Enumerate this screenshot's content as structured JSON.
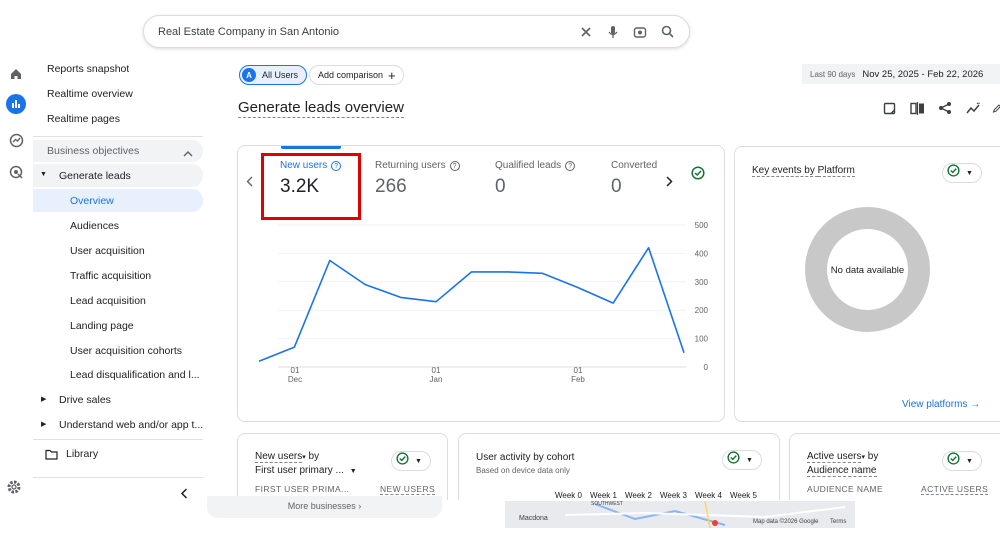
{
  "search": {
    "query": "Real Estate Company in San Antonio"
  },
  "nav": {
    "items": [
      "Reports snapshot",
      "Realtime overview",
      "Realtime pages"
    ],
    "section": "Business objectives",
    "group": "Generate leads",
    "group_items": [
      "Overview",
      "Audiences",
      "User acquisition",
      "Traffic acquisition",
      "Lead acquisition",
      "Landing page",
      "User acquisition cohorts",
      "Lead disqualification and l..."
    ],
    "collapsed": [
      "Drive sales",
      "Understand web and/or app t..."
    ],
    "library": "Library",
    "more_businesses": "More businesses"
  },
  "header": {
    "all_users_chip": {
      "avatar": "A",
      "label": "All Users"
    },
    "add_comparison": "Add comparison",
    "date_label": "Last 90 days",
    "date_range": "Nov 25, 2025 - Feb 22, 2026",
    "title": "Generate leads overview"
  },
  "metrics": [
    {
      "label": "New users",
      "value": "3.2K"
    },
    {
      "label": "Returning users",
      "value": "266"
    },
    {
      "label": "Qualified leads",
      "value": "0"
    },
    {
      "label": "Converted",
      "value": "0"
    }
  ],
  "chart_data": {
    "type": "line",
    "x_tick_labels": [
      [
        "01",
        "Dec"
      ],
      [
        "01",
        "Jan"
      ],
      [
        "01",
        "Feb"
      ]
    ],
    "y_ticks": [
      0,
      100,
      200,
      300,
      400,
      500
    ],
    "ylim": [
      0,
      500
    ],
    "values": [
      20,
      70,
      375,
      290,
      245,
      230,
      335,
      335,
      330,
      280,
      225,
      420,
      50
    ],
    "color": "#1a73e8"
  },
  "platform_card": {
    "title_prefix": "Key events by ",
    "title_link": "Platform",
    "empty_text": "No data available",
    "link": "View platforms"
  },
  "bottom_cards": {
    "new_users": {
      "title": "New users",
      "by": "by",
      "dimension": "First user primary ...",
      "col1": "FIRST USER PRIMA...",
      "col2": "NEW USERS"
    },
    "cohort": {
      "title": "User activity by cohort",
      "subtitle": "Based on device data only",
      "weeks": [
        "Week 0",
        "Week 1",
        "Week 2",
        "Week 3",
        "Week 4",
        "Week 5"
      ]
    },
    "active_users": {
      "title": "Active users",
      "by": "by",
      "dimension": "Audience name",
      "col1": "AUDIENCE NAME",
      "col2": "ACTIVE USERS"
    }
  },
  "map": {
    "place": "Macdona",
    "credit": "Map data ©2026 Google",
    "terms": "Terms",
    "area": "SOUTHWEST"
  },
  "colors": {
    "accent": "#1a73e8",
    "highlight": "#e00000",
    "check": "#137333"
  }
}
